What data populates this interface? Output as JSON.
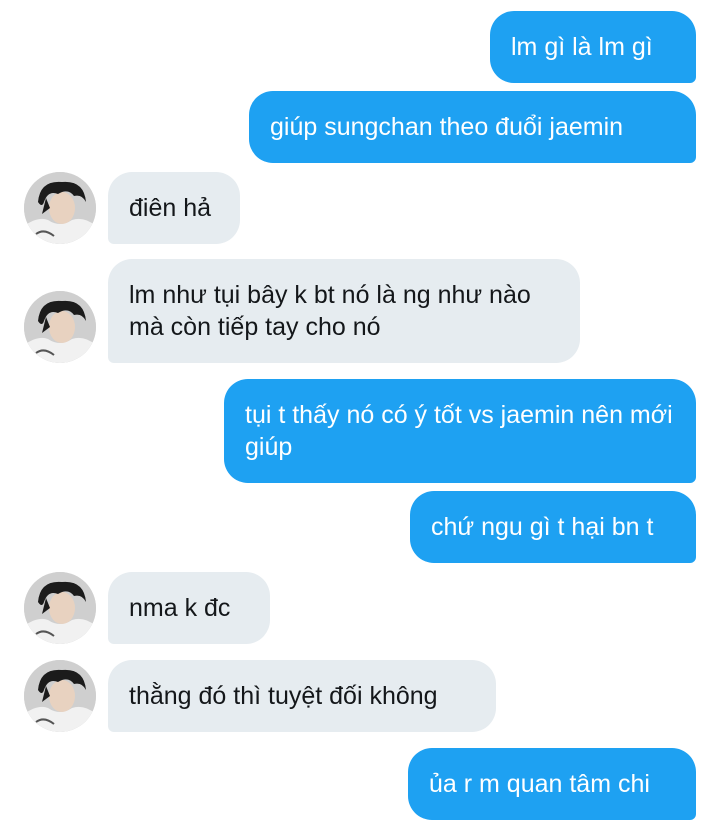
{
  "conversation": {
    "messages": [
      {
        "side": "out",
        "text": "lm gì là lm gì"
      },
      {
        "side": "out",
        "text": "giúp sungchan theo đuổi jaemin"
      },
      {
        "side": "in",
        "text": "điên hả"
      },
      {
        "side": "in",
        "text": "lm như tụi bây k bt nó là ng như nào mà còn tiếp tay cho nó"
      },
      {
        "side": "out",
        "text": "tụi t thấy nó có ý tốt vs jaemin nên mới giúp"
      },
      {
        "side": "out",
        "text": "chứ ngu gì t hại bn t"
      },
      {
        "side": "in",
        "text": "nma k đc"
      },
      {
        "side": "in",
        "text": "thằng đó thì tuyệt đối không"
      },
      {
        "side": "out",
        "text": "ủa r m quan tâm chi"
      }
    ]
  },
  "colors": {
    "outgoing_bubble": "#1ea1f2",
    "incoming_bubble": "#e6ecf0",
    "incoming_text": "#14171a",
    "background": "#ffffff"
  },
  "icons": {
    "avatar": "contact-avatar-photo"
  }
}
